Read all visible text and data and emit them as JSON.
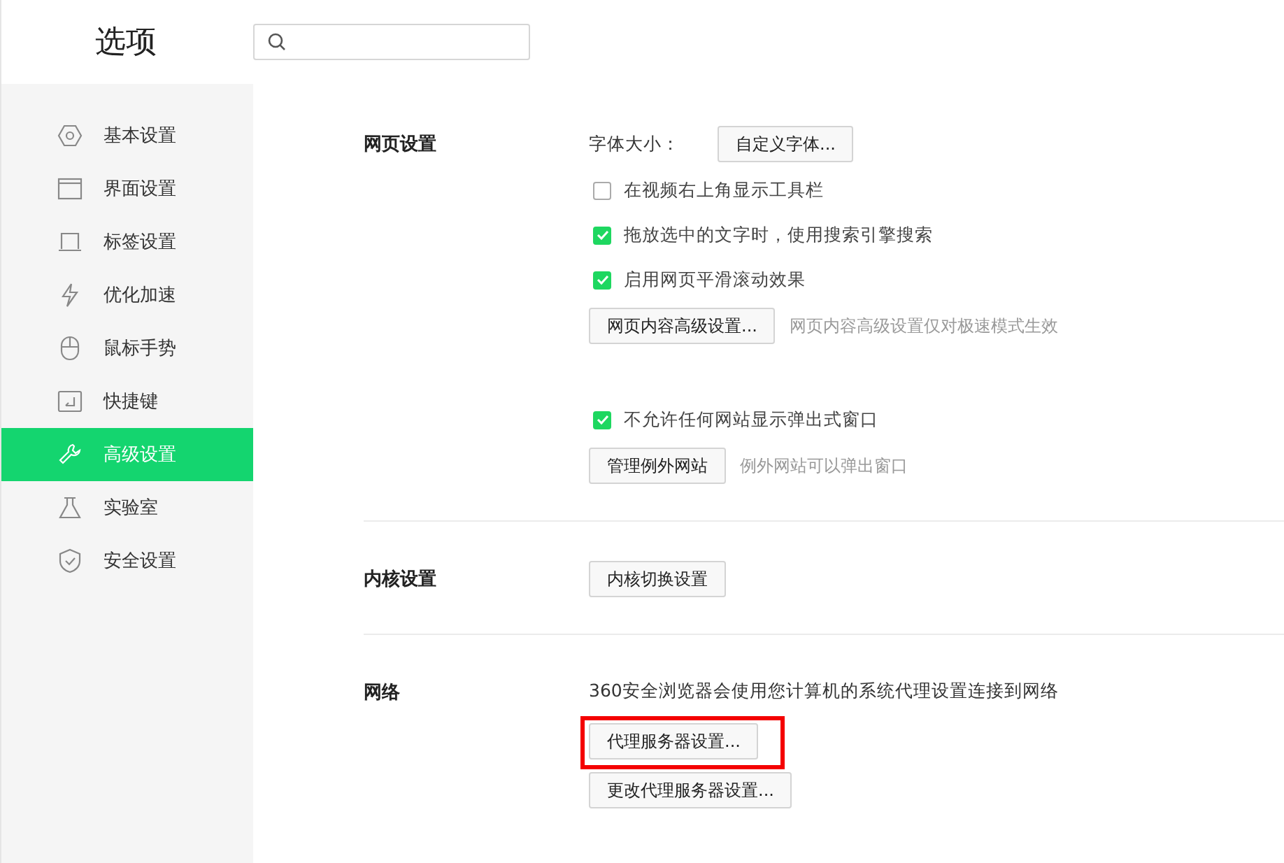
{
  "window": {
    "title": "选项"
  },
  "sidebar": {
    "items": [
      {
        "label": "基本设置",
        "selected": false
      },
      {
        "label": "界面设置",
        "selected": false
      },
      {
        "label": "标签设置",
        "selected": false
      },
      {
        "label": "优化加速",
        "selected": false
      },
      {
        "label": "鼠标手势",
        "selected": false
      },
      {
        "label": "快捷键",
        "selected": false
      },
      {
        "label": "高级设置",
        "selected": true
      },
      {
        "label": "实验室",
        "selected": false
      },
      {
        "label": "安全设置",
        "selected": false
      }
    ]
  },
  "sections": [
    {
      "title": "网页设置",
      "groups": [
        [
          {
            "kind": "labeled-button",
            "label": "字体大小：",
            "button": "自定义字体..."
          },
          {
            "kind": "checkbox",
            "label": "在视频右上角显示工具栏",
            "checked": false
          },
          {
            "kind": "checkbox",
            "label": "拖放选中的文字时，使用搜索引擎搜索",
            "checked": true
          },
          {
            "kind": "checkbox",
            "label": "启用网页平滑滚动效果",
            "checked": true
          },
          {
            "kind": "button",
            "button": "网页内容高级设置...",
            "note": "网页内容高级设置仅对极速模式生效"
          }
        ],
        [
          {
            "kind": "checkbox",
            "label": "不允许任何网站显示弹出式窗口",
            "checked": true
          },
          {
            "kind": "button",
            "button": "管理例外网站",
            "note": "例外网站可以弹出窗口"
          }
        ]
      ]
    },
    {
      "title": "内核设置",
      "groups": [
        [
          {
            "kind": "button",
            "button": "内核切换设置"
          }
        ]
      ]
    },
    {
      "title": "网络",
      "groups": [
        [
          {
            "kind": "text",
            "text": "360安全浏览器会使用您计算机的系统代理设置连接到网络"
          },
          {
            "kind": "button",
            "button": "代理服务器设置...",
            "highlighted": true
          },
          {
            "kind": "button",
            "button": "更改代理服务器设置..."
          }
        ]
      ]
    }
  ]
}
